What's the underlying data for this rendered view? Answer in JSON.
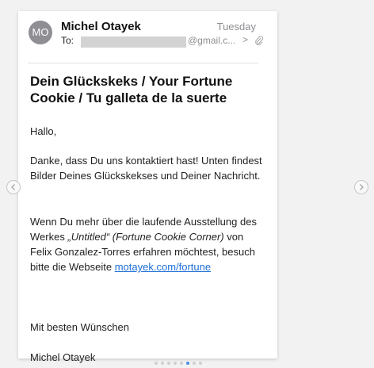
{
  "email": {
    "avatar_initials": "MO",
    "sender": "Michel Otayek",
    "date": "Tuesday",
    "to_label": "To:",
    "to_address": "@gmail.c...",
    "to_chevron": ">",
    "subject": "Dein Glückskeks / Your Fortune Cookie / Tu galleta de la suerte",
    "body": {
      "greeting": "Hallo,",
      "p2": "Danke, dass Du uns kontaktiert hast! Unten findest Bilder Deines Glückskekses und Deiner Nachricht.",
      "p3_start": "Wenn Du mehr über die laufende Ausstellung des Werkes ",
      "p3_italic": "„Untitled“ (Fortune Cookie Corner)",
      "p3_middle": " von Felix Gonzalez-Torres erfahren möchtest, besuch bitte die Webseite ",
      "p3_link": "motayek.com/fortune",
      "closing": "Mit besten Wünschen",
      "signature": "Michel Otayek"
    }
  },
  "carousel": {
    "dot_count": 8,
    "active_index": 5,
    "icons": {
      "prev": "chevron-left-icon",
      "next": "chevron-right-icon"
    }
  },
  "colors": {
    "accent": "#4a90e2",
    "link": "#1d6fd6",
    "avatar": "#8e8e93"
  }
}
